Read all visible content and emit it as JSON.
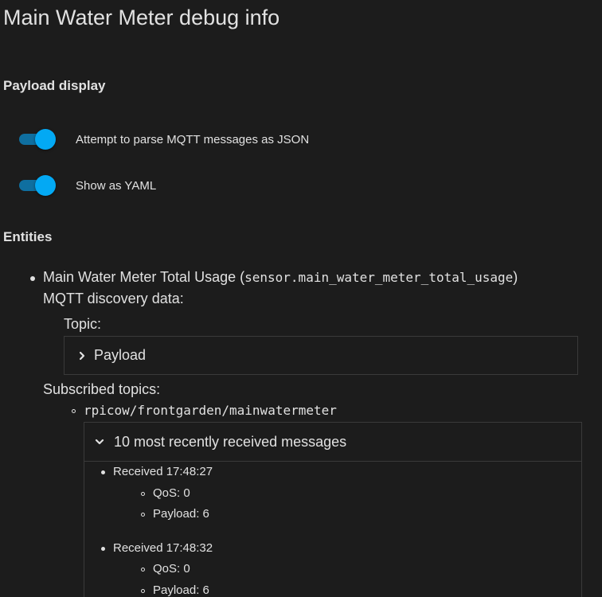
{
  "page": {
    "title": "Main Water Meter debug info"
  },
  "payload_display": {
    "heading": "Payload display",
    "toggles": [
      {
        "label": "Attempt to parse MQTT messages as JSON",
        "checked": true
      },
      {
        "label": "Show as YAML",
        "checked": true
      }
    ]
  },
  "entities": {
    "heading": "Entities",
    "items": [
      {
        "name": "Main Water Meter Total Usage",
        "open_paren": "(",
        "entity_id": "sensor.main_water_meter_total_usage",
        "close_paren": ")",
        "discovery_label": "MQTT discovery data:",
        "topic_label": "Topic:",
        "payload_label": "Payload",
        "subscribed_label": "Subscribed topics:",
        "topics": [
          {
            "topic": "rpicow/frontgarden/mainwatermeter",
            "messages_header": "10 most recently received messages",
            "messages": [
              {
                "received": "Received 17:48:27",
                "qos": "QoS: 0",
                "payload": "Payload: 6"
              },
              {
                "received": "Received 17:48:32",
                "qos": "QoS: 0",
                "payload": "Payload: 6"
              }
            ]
          }
        ]
      }
    ]
  },
  "colors": {
    "background": "#1c1c1c",
    "text": "#e1e1e1",
    "accent": "#03a9f4",
    "border": "#3a3a3a"
  },
  "icons": {
    "payload_expander": "chevron-right-icon",
    "messages_expander": "chevron-down-icon"
  }
}
